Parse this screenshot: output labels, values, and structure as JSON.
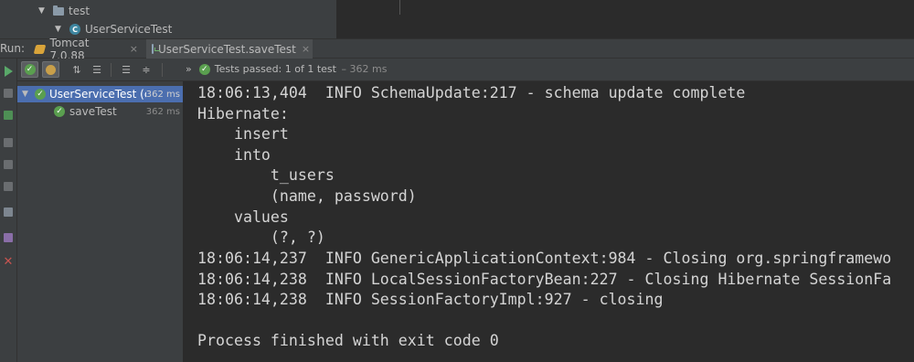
{
  "project_tree": {
    "folder_label": "test",
    "class_label": "UserServiceTest",
    "class_icon_letter": "C"
  },
  "run_bar": {
    "run_label": "Run:",
    "tabs": [
      {
        "label": "Tomcat 7.0.88",
        "icon": "tomcat-icon"
      },
      {
        "label": "UserServiceTest.saveTest",
        "icon": "junit-icon"
      }
    ],
    "close_glyph": "×"
  },
  "toolbar": {
    "status_prefix": "Tests passed:",
    "status_count": "1 of 1 test",
    "status_time": "– 362 ms",
    "overflow_glyph": "»"
  },
  "test_tree": {
    "root": {
      "name": "UserServiceTest (c",
      "time": "362 ms"
    },
    "child": {
      "name": "saveTest",
      "time": "362 ms"
    }
  },
  "console": {
    "lines": [
      "18:06:13,404  INFO SchemaUpdate:217 - schema update complete",
      "Hibernate:",
      "    insert",
      "    into",
      "        t_users",
      "        (name, password)",
      "    values",
      "        (?, ?)",
      "18:06:14,237  INFO GenericApplicationContext:984 - Closing org.springframewo",
      "18:06:14,238  INFO LocalSessionFactoryBean:227 - Closing Hibernate SessionFa",
      "18:06:14,238  INFO SessionFactoryImpl:927 - closing",
      "",
      "Process finished with exit code 0"
    ]
  },
  "colors": {
    "background": "#2b2b2b",
    "panel": "#3c3f41",
    "selection": "#4b6eaf",
    "pass_green": "#5a9f4f"
  }
}
